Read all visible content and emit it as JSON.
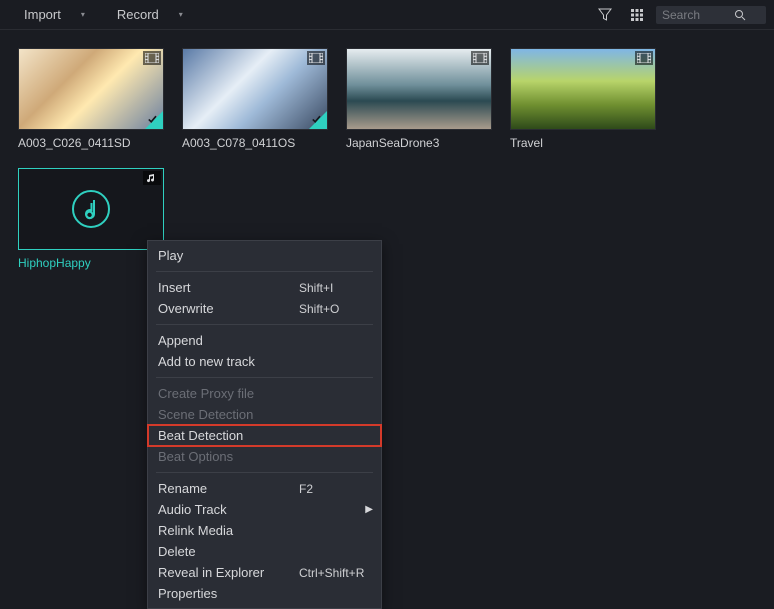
{
  "toolbar": {
    "import_label": "Import",
    "record_label": "Record",
    "search_placeholder": "Search"
  },
  "media": [
    {
      "label": "A003_C026_0411SD",
      "type": "video",
      "checked": true,
      "thumb": "v1"
    },
    {
      "label": "A003_C078_0411OS",
      "type": "video",
      "checked": true,
      "thumb": "v2"
    },
    {
      "label": "JapanSeaDrone3",
      "type": "video",
      "checked": false,
      "thumb": "v3"
    },
    {
      "label": "Travel",
      "type": "video",
      "checked": false,
      "thumb": "v4"
    },
    {
      "label": "HiphopHappy",
      "type": "audio",
      "checked": false,
      "selected": true
    }
  ],
  "context_menu": {
    "groups": [
      [
        {
          "label": "Play"
        }
      ],
      [
        {
          "label": "Insert",
          "shortcut": "Shift+I"
        },
        {
          "label": "Overwrite",
          "shortcut": "Shift+O"
        }
      ],
      [
        {
          "label": "Append"
        },
        {
          "label": "Add to new track"
        }
      ],
      [
        {
          "label": "Create Proxy file",
          "disabled": true
        },
        {
          "label": "Scene Detection",
          "disabled": true
        },
        {
          "label": "Beat Detection",
          "highlight": true
        },
        {
          "label": "Beat Options",
          "disabled": true
        }
      ],
      [
        {
          "label": "Rename",
          "shortcut": "F2"
        },
        {
          "label": "Audio Track",
          "submenu": true
        },
        {
          "label": "Relink Media"
        },
        {
          "label": "Delete"
        },
        {
          "label": "Reveal in Explorer",
          "shortcut": "Ctrl+Shift+R"
        },
        {
          "label": "Properties"
        }
      ]
    ]
  },
  "icons": {
    "filter": "filter-icon",
    "grid": "grid-icon",
    "search": "search-icon",
    "chevron_down": "chevron-down-icon",
    "video_badge": "filmstrip-icon",
    "audio_badge": "music-note-icon",
    "checkmark": "checkmark-icon",
    "music_note_large": "music-note-large-icon"
  }
}
